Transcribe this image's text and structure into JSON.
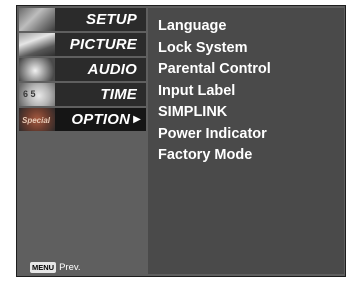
{
  "tabs": [
    {
      "label": "SETUP",
      "icon": "satellite-dish-icon",
      "selected": false
    },
    {
      "label": "PICTURE",
      "icon": "film-strip-icon",
      "selected": false
    },
    {
      "label": "AUDIO",
      "icon": "speaker-icon",
      "selected": false
    },
    {
      "label": "TIME",
      "icon": "clock-icon",
      "selected": false
    },
    {
      "label": "OPTION",
      "icon": "special-icon",
      "selected": true,
      "arrow": "▶"
    }
  ],
  "thumb_text": {
    "time_digits": "6  5",
    "option_text": "Special"
  },
  "menu": {
    "items": [
      "Language",
      "Lock System",
      "Parental Control",
      "Input Label",
      "SIMPLINK",
      "Power Indicator",
      "Factory Mode"
    ]
  },
  "footer": {
    "key": "MENU",
    "label": "Prev."
  },
  "colors": {
    "frame": "#5f5f5f",
    "panel": "#4a4a4a",
    "tab": "#2b2b2b",
    "tab_selected": "#151515",
    "text": "#ffffff"
  }
}
